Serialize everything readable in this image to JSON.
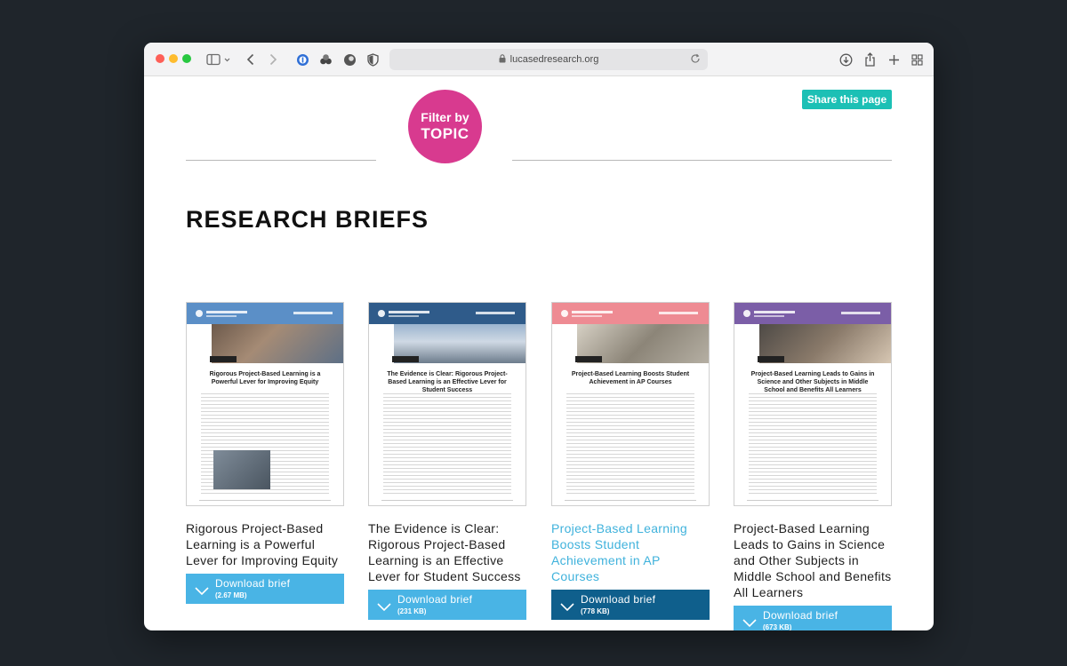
{
  "browser": {
    "url": "lucasedresearch.org"
  },
  "page": {
    "filter_badge": {
      "line1": "Filter by",
      "line2": "TOPIC"
    },
    "share_button": "Share this page",
    "heading": "RESEARCH BRIEFS"
  },
  "cards": [
    {
      "title": "Rigorous Project-Based Learning is a Powerful Lever for Improving Equity",
      "thumb_title": "Rigorous Project-Based Learning is a Powerful Lever for Improving Equity",
      "download_label": "Download brief",
      "size": "(2.67 MB)",
      "accent": "#5b8fc7",
      "active": false
    },
    {
      "title": "The Evidence is Clear: Rigorous Project-Based Learning is an Effective Lever for Student Success",
      "thumb_title": "The Evidence is Clear: Rigorous Project-Based Learning is an Effective Lever for Student Success",
      "download_label": "Download brief",
      "size": "(231 KB)",
      "accent": "#2f5b8a",
      "active": false
    },
    {
      "title": "Project-Based Learning Boosts Student Achievement in AP Courses",
      "thumb_title": "Project-Based Learning Boosts Student Achievement in AP Courses",
      "download_label": "Download brief",
      "size": "(778 KB)",
      "accent": "#ee8b93",
      "active": true
    },
    {
      "title": "Project-Based Learning Leads to Gains in Science and Other Subjects in Middle School and Benefits All Learners",
      "thumb_title": "Project-Based Learning Leads to Gains in Science and Other Subjects in Middle School and Benefits All Learners",
      "download_label": "Download brief",
      "size": "(673 KB)",
      "accent": "#7b5ea7",
      "active": false
    }
  ],
  "colors": {
    "filter_badge": "#d83a8f",
    "share_button": "#1cc0b5",
    "download_button": "#49b4e5",
    "download_button_active": "#0f5f8c",
    "active_title": "#3fb2dc"
  }
}
